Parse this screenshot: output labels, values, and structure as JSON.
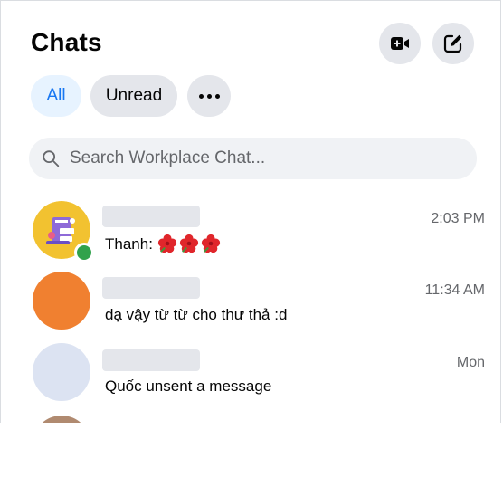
{
  "header": {
    "title": "Chats"
  },
  "filters": {
    "all": "All",
    "unread": "Unread"
  },
  "search": {
    "placeholder": "Search Workplace Chat..."
  },
  "chats": [
    {
      "time": "2:03 PM",
      "preview_sender": "Thanh: ",
      "preview_emoji": "hibiscus x3",
      "online": true,
      "avatar_color": "#f2c230"
    },
    {
      "time": "11:34 AM",
      "preview": "dạ vậy từ từ cho thư thả :d",
      "online": false,
      "avatar_color": "#f08030"
    },
    {
      "time": "Mon",
      "preview": "Quốc unsent a message",
      "online": false,
      "avatar_color": "#dce3f2"
    }
  ],
  "colors": {
    "accent": "#1877f2",
    "online": "#31a24c",
    "pill": "#e4e6eb",
    "search_bg": "#f0f2f5"
  }
}
